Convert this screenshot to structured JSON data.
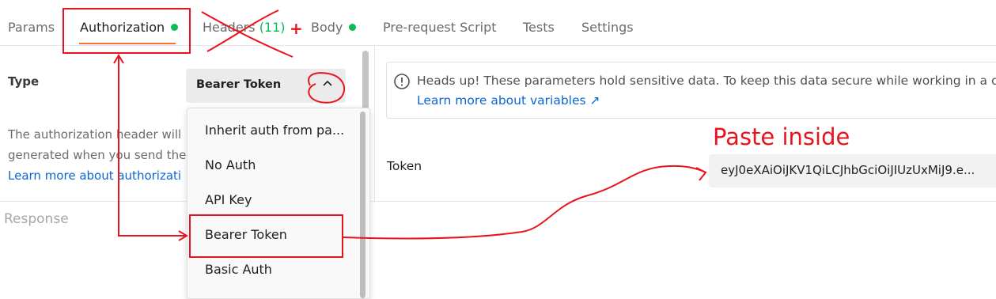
{
  "tabs": [
    {
      "label": "Params"
    },
    {
      "label": "Authorization",
      "status_dot": true
    },
    {
      "label": "Headers",
      "count": "(11)"
    },
    {
      "label": "Body",
      "status_dot": true
    },
    {
      "label": "Pre-request Script"
    },
    {
      "label": "Tests"
    },
    {
      "label": "Settings"
    }
  ],
  "auth": {
    "type_label": "Type",
    "selected_type": "Bearer Token",
    "description_line1": "The authorization header will",
    "description_line2": "generated when you send the",
    "description_link": "Learn more about authorizati"
  },
  "dropdown": {
    "items": [
      "Inherit auth from pa...",
      "No Auth",
      "API Key",
      "Bearer Token",
      "Basic Auth"
    ],
    "selected": "Bearer Token"
  },
  "alert": {
    "icon": "info-circle-icon",
    "text": "Heads up! These parameters hold sensitive data. To keep this data secure while working in a c",
    "link": "Learn more about variables ↗"
  },
  "token": {
    "label": "Token",
    "value": "eyJ0eXAiOiJKV1QiLCJhbGciOiJIUzUxMiJ9.e..."
  },
  "response": {
    "label": "Response"
  },
  "annotations": {
    "paste_note": "Paste inside",
    "plus_mark": "+",
    "annotation_color": "#e8141b"
  },
  "colors": {
    "accent": "#ff6c37",
    "status_green": "#0cbb52",
    "link": "#0b66d3"
  }
}
